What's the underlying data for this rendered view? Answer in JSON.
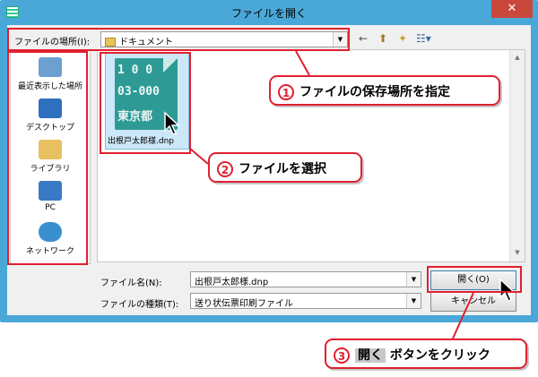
{
  "window": {
    "title": "ファイルを開く",
    "close_label": "✕"
  },
  "location": {
    "label": "ファイルの場所(I):",
    "value": "ドキュメント"
  },
  "toolbar": {
    "back": "←",
    "up": "⬆",
    "new_folder": "✦",
    "view": "☷▾"
  },
  "places": [
    {
      "label": "最近表示した場所",
      "icon": "recent-places-icon",
      "color": "#6d9fd0"
    },
    {
      "label": "デスクトップ",
      "icon": "desktop-icon",
      "color": "#2f6fbf"
    },
    {
      "label": "ライブラリ",
      "icon": "library-icon",
      "color": "#e8c060"
    },
    {
      "label": "PC",
      "icon": "pc-icon",
      "color": "#3a79c5"
    },
    {
      "label": "ネットワーク",
      "icon": "network-icon",
      "color": "#3a8fd0"
    }
  ],
  "file": {
    "name": "出根戸太郎様.dnp",
    "thumb_lines": [
      "1 0 0",
      "03-000",
      "東京都"
    ]
  },
  "filename": {
    "label": "ファイル名(N):",
    "value": "出根戸太郎様.dnp"
  },
  "filetype": {
    "label": "ファイルの種類(T):",
    "value": "送り状伝票印刷ファイル"
  },
  "buttons": {
    "open": "開く(O)",
    "cancel": "キャンセル"
  },
  "callouts": {
    "one": {
      "num": "1",
      "text": "ファイルの保存場所を指定"
    },
    "two": {
      "num": "2",
      "text": "ファイルを選択"
    },
    "three": {
      "num": "3",
      "highlight": "開く",
      "text": "ボタンをクリック"
    }
  },
  "colors": {
    "accent": "#e02030",
    "titlebar": "#4aa8d8",
    "selection": "#cce8f8"
  }
}
